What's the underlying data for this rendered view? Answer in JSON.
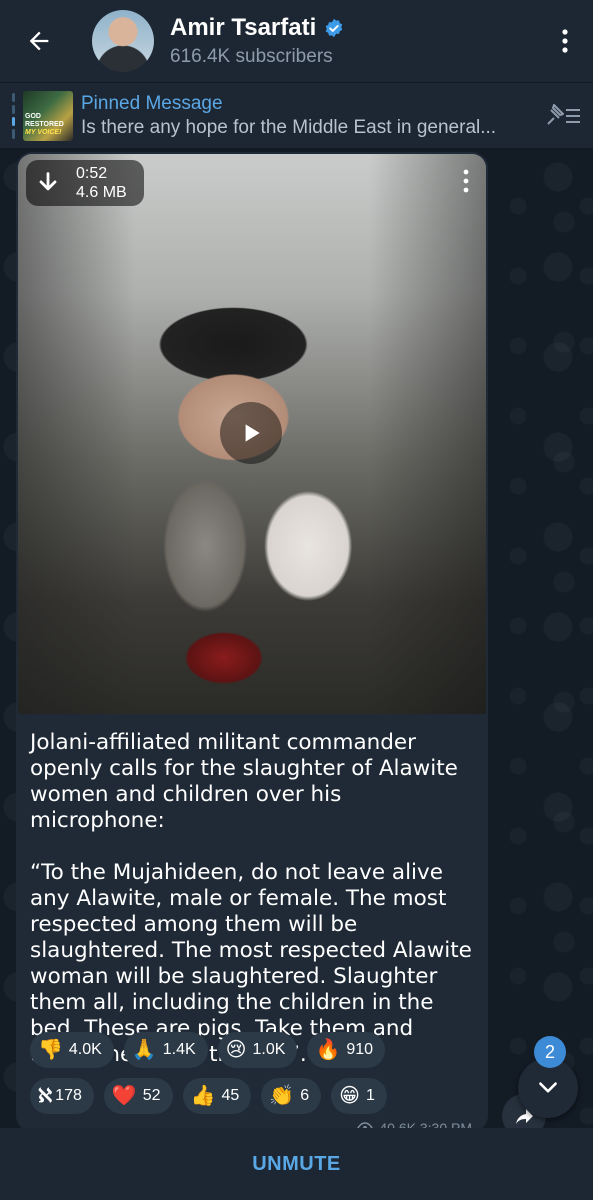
{
  "header": {
    "channel_name": "Amir Tsarfati",
    "subscribers": "616.4K subscribers"
  },
  "pinned": {
    "label": "Pinned Message",
    "snippet": "Is there any hope for the Middle East in general...",
    "thumb_line1": "GOD RESTORED",
    "thumb_line2": "MY VOICE!"
  },
  "video": {
    "duration": "0:52",
    "size": "4.6 MB"
  },
  "message": {
    "paragraph1": "Jolani-affiliated militant commander openly calls for the slaughter of Alawite women and children over his microphone:",
    "paragraph2": "“To the Mujahideen, do not leave alive any Alawite, male or female. The most respected among them will be slaughtered. The most respected Alawite woman will be slaughtered. Slaughter them all, including the children in the bed. These are pigs. Take them and throw them into the sea”.",
    "footer": "40.6K  3:30 PM"
  },
  "reactions": {
    "row1": [
      {
        "emoji": "👎",
        "count": "4.0K"
      },
      {
        "emoji": "🙏",
        "count": "1.4K"
      },
      {
        "emoji": "😢",
        "count": "1.0K"
      },
      {
        "emoji": "🔥",
        "count": "910"
      }
    ],
    "row2": [
      {
        "emoji": "ℵ",
        "count": "178"
      },
      {
        "emoji": "❤️",
        "count": "52"
      },
      {
        "emoji": "👍",
        "count": "45"
      },
      {
        "emoji": "👏",
        "count": "6"
      },
      {
        "emoji": "😁",
        "count": "1"
      }
    ]
  },
  "unread_count": "2",
  "bottom": {
    "unmute_label": "UNMUTE"
  },
  "colors": {
    "accent": "#5aa7e6",
    "header_bg": "#1d2733",
    "bubble_bg": "#1f2a36",
    "chat_bg": "#131b25"
  }
}
